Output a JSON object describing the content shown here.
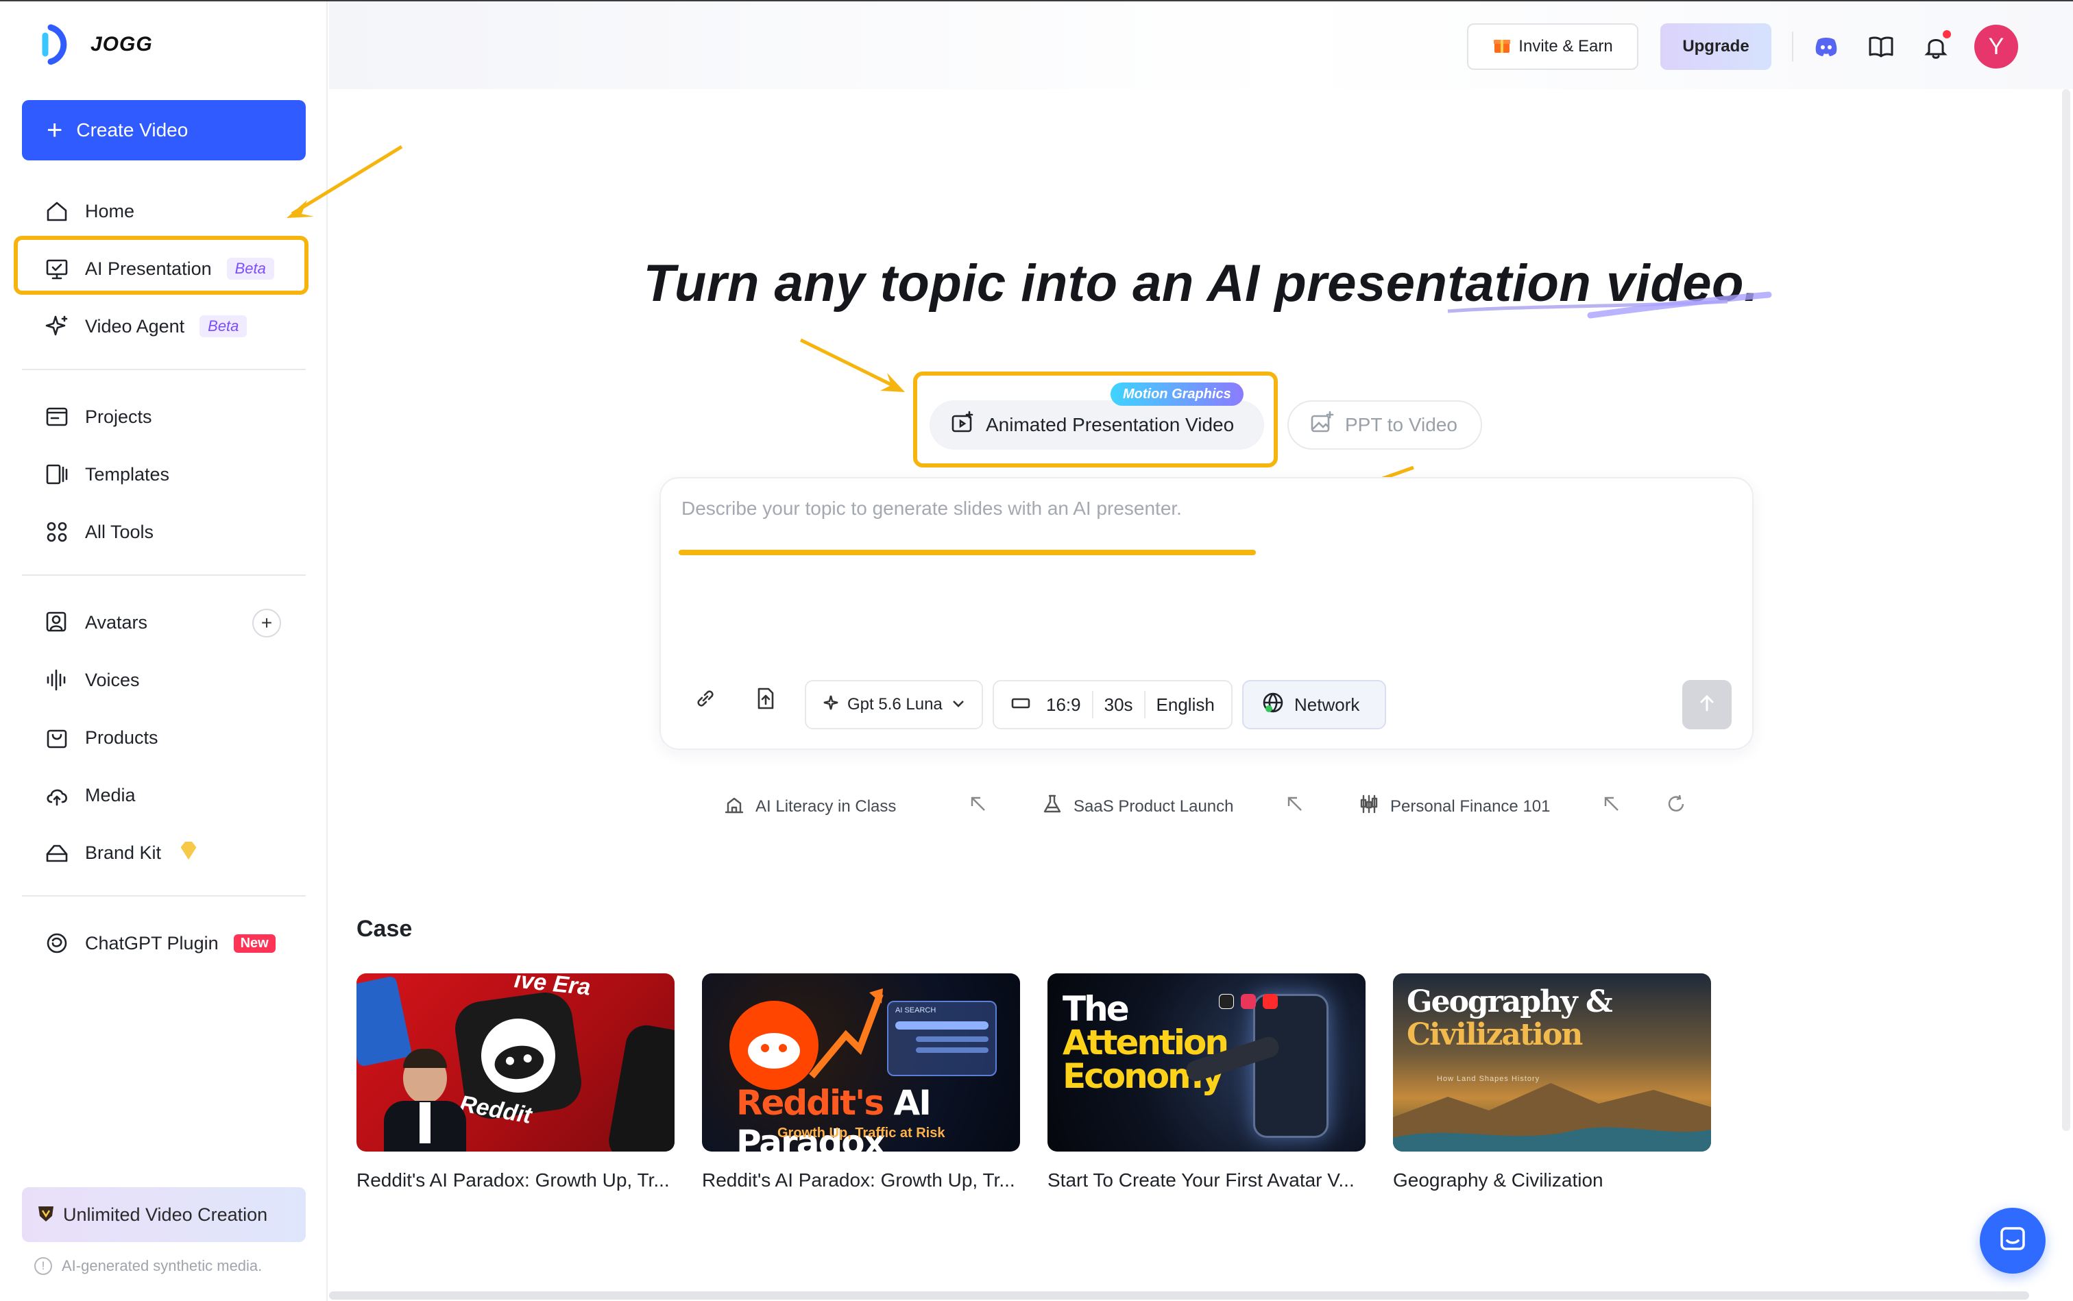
{
  "brand": {
    "name": "JOGG"
  },
  "sidebar": {
    "create_label": "Create Video",
    "items": [
      {
        "label": "Home",
        "icon": "home-icon"
      },
      {
        "label": "AI Presentation",
        "icon": "presentation-icon",
        "badge": "Beta"
      },
      {
        "label": "Video Agent",
        "icon": "sparkle-icon",
        "badge": "Beta"
      },
      {
        "label": "Projects",
        "icon": "folder-icon"
      },
      {
        "label": "Templates",
        "icon": "templates-icon"
      },
      {
        "label": "All Tools",
        "icon": "grid-icon"
      },
      {
        "label": "Avatars",
        "icon": "avatar-icon"
      },
      {
        "label": "Voices",
        "icon": "waveform-icon"
      },
      {
        "label": "Products",
        "icon": "bag-icon"
      },
      {
        "label": "Media",
        "icon": "cloud-upload-icon"
      },
      {
        "label": "Brand Kit",
        "icon": "brand-kit-icon"
      },
      {
        "label": "ChatGPT Plugin",
        "icon": "chatgpt-icon",
        "badge": "New"
      }
    ],
    "unlimited_label": "Unlimited Video Creation",
    "synthetic_note": "AI-generated synthetic media."
  },
  "header": {
    "invite_label": "Invite & Earn",
    "upgrade_label": "Upgrade",
    "avatar_initial": "Y"
  },
  "hero": {
    "title": "Turn any topic into an AI presentation video."
  },
  "modes": {
    "tag": "Motion Graphics",
    "active_label": "Animated Presentation Video",
    "inactive_label": "PPT to Video"
  },
  "prompt": {
    "placeholder": "Describe your topic to generate slides with an AI presenter.",
    "model": "Gpt 5.6 Luna",
    "ratio": "16:9",
    "duration": "30s",
    "language": "English",
    "network": "Network"
  },
  "suggestions": [
    {
      "label": "AI Literacy in Class",
      "icon": "school-icon"
    },
    {
      "label": "SaaS Product Launch",
      "icon": "flask-icon"
    },
    {
      "label": "Personal Finance 101",
      "icon": "candlestick-icon"
    }
  ],
  "cases": {
    "title": "Case",
    "items": [
      {
        "label": "Reddit's AI Paradox: Growth Up, Tr...",
        "thumb_text_1": "Reddit",
        "thumb_text_2": "ive Era"
      },
      {
        "label": "Reddit's AI Paradox: Growth Up, Tr...",
        "thumb_text_1": "Reddit's",
        "thumb_text_2": "AI Paradox",
        "thumb_text_3": "Growth Up, Traffic at Risk",
        "thumb_text_4": "AI SEARCH"
      },
      {
        "label": "Start To Create Your First Avatar V...",
        "thumb_text_1": "The",
        "thumb_text_2": "Attention",
        "thumb_text_3": "Economy"
      },
      {
        "label": "Geography & Civilization",
        "thumb_text_1": "Geography &",
        "thumb_text_2": "Civilization",
        "thumb_text_3": "How Land Shapes History"
      }
    ]
  },
  "colors": {
    "accent": "#2f5bff",
    "highlight": "#f6b40e",
    "beta_text": "#7c4dff",
    "new_badge": "#ff3355"
  }
}
